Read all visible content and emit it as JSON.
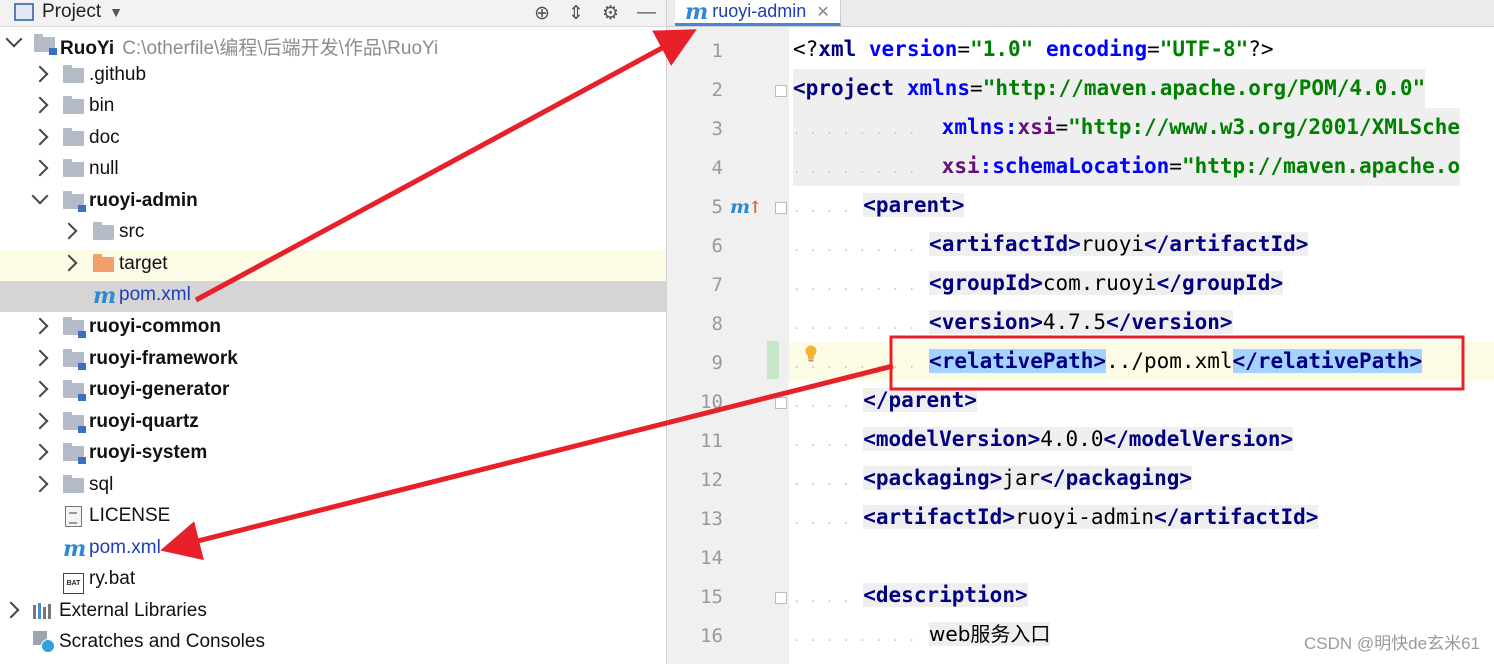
{
  "project_panel": {
    "title": "Project",
    "tree": [
      {
        "label": "RuoYi",
        "path": "C:\\otherfile\\编程\\后端开发\\作品\\RuoYi"
      },
      {
        "label": ".github"
      },
      {
        "label": "bin"
      },
      {
        "label": "doc"
      },
      {
        "label": "null"
      },
      {
        "label": "ruoyi-admin"
      },
      {
        "label": "src"
      },
      {
        "label": "target"
      },
      {
        "label": "pom.xml"
      },
      {
        "label": "ruoyi-common"
      },
      {
        "label": "ruoyi-framework"
      },
      {
        "label": "ruoyi-generator"
      },
      {
        "label": "ruoyi-quartz"
      },
      {
        "label": "ruoyi-system"
      },
      {
        "label": "sql"
      },
      {
        "label": "LICENSE"
      },
      {
        "label": "pom.xml"
      },
      {
        "label": "ry.bat"
      },
      {
        "label": "External Libraries"
      },
      {
        "label": "Scratches and Consoles"
      }
    ]
  },
  "editor": {
    "tab_label": "ruoyi-admin",
    "tab_icon_glyph": "m",
    "line_numbers": [
      "1",
      "2",
      "3",
      "4",
      "5",
      "6",
      "7",
      "8",
      "9",
      "10",
      "11",
      "12",
      "13",
      "14",
      "15",
      "16"
    ],
    "code": {
      "l1": {
        "a": "<?",
        "b": "xml",
        "c": "version",
        "d": "=",
        "e": "\"1.0\"",
        "f": "encoding",
        "g": "=",
        "h": "\"UTF-8\"",
        "i": "?>"
      },
      "l2": {
        "a": "<",
        "b": "project",
        "c": "xmlns",
        "d": "=",
        "e": "\"http://maven.apache.org/POM/4.0.0\""
      },
      "l3": {
        "a": "xmlns",
        "b": ":",
        "c": "xsi",
        "d": "=",
        "e": "\"http://www.w3.org/2001/XMLSche"
      },
      "l4": {
        "a": "xsi",
        "b": ":",
        "c": "schemaLocation",
        "d": "=",
        "e": "\"http://maven.apache.o"
      },
      "l5": {
        "a": "<",
        "b": "parent",
        "c": ">"
      },
      "l6": {
        "a": "<",
        "b": "artifactId",
        "c": ">",
        "d": "ruoyi",
        "e": "</",
        "f": "artifactId",
        "g": ">"
      },
      "l7": {
        "a": "<",
        "b": "groupId",
        "c": ">",
        "d": "com.ruoyi",
        "e": "</",
        "f": "groupId",
        "g": ">"
      },
      "l8": {
        "a": "<",
        "b": "version",
        "c": ">",
        "d": "4.7.5",
        "e": "</",
        "f": "version",
        "g": ">"
      },
      "l9": {
        "a": "<",
        "b": "relativePath",
        "c": ">",
        "d": "../pom.xml",
        "e": "</",
        "f": "relativePath",
        "g": ">"
      },
      "l10": {
        "a": "</",
        "b": "parent",
        "c": ">"
      },
      "l11": {
        "a": "<",
        "b": "modelVersion",
        "c": ">",
        "d": "4.0.0",
        "e": "</",
        "f": "modelVersion",
        "g": ">"
      },
      "l12": {
        "a": "<",
        "b": "packaging",
        "c": ">",
        "d": "jar",
        "e": "</",
        "f": "packaging",
        "g": ">"
      },
      "l13": {
        "a": "<",
        "b": "artifactId",
        "c": ">",
        "d": "ruoyi-admin",
        "e": "</",
        "f": "artifactId",
        "g": ">"
      },
      "l15": {
        "a": "<",
        "b": "description",
        "c": ">"
      },
      "l16": {
        "a": "web服务入口"
      }
    }
  },
  "watermark": "CSDN @明快de玄米61",
  "colors": {
    "annotation_red": "#e8202a",
    "selection": "#a6d2ff",
    "tag": "#000080",
    "attribute": "#0000ff",
    "string": "#008000"
  }
}
